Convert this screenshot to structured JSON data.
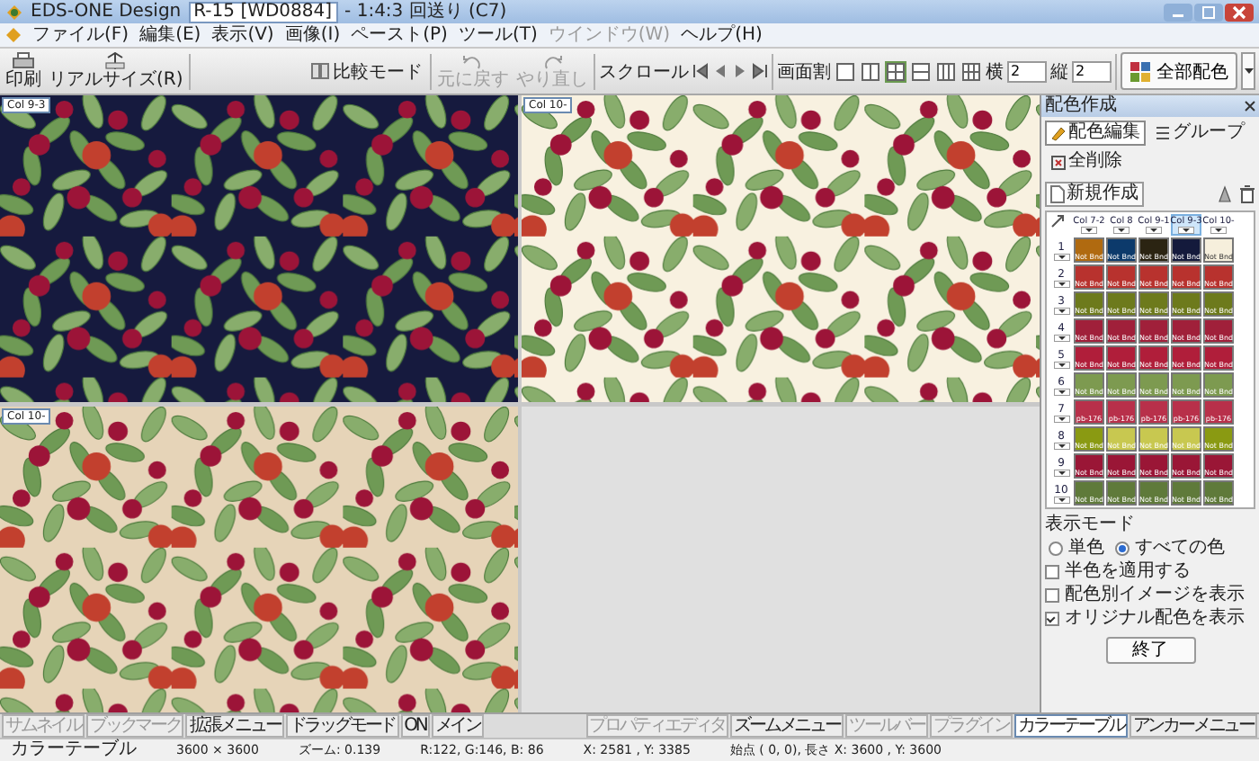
{
  "window": {
    "title": "EDS-ONE Design",
    "document": "R-15 [WD0884]",
    "subtitle": "- 1:4:3 回送り (C7)"
  },
  "menu": [
    {
      "label": "ファイル(F)",
      "disabled": false
    },
    {
      "label": "編集(E)",
      "disabled": false
    },
    {
      "label": "表示(V)",
      "disabled": false
    },
    {
      "label": "画像(I)",
      "disabled": false
    },
    {
      "label": "ペースト(P)",
      "disabled": false
    },
    {
      "label": "ツール(T)",
      "disabled": false
    },
    {
      "label": "ウインドウ(W)",
      "disabled": true
    },
    {
      "label": "ヘルプ(H)",
      "disabled": false
    }
  ],
  "toolbar": {
    "print": "印刷",
    "real_size": "リアルサイズ(R)",
    "compare": "比較モード",
    "undo": {
      "label": "元に戻す",
      "disabled": true
    },
    "redo": {
      "label": "やり直し",
      "disabled": true
    },
    "scroll": "スクロール",
    "split": {
      "label": "画面割",
      "layouts": [
        {
          "selected": false
        },
        {
          "selected": false
        },
        {
          "selected": true
        },
        {
          "selected": false
        },
        {
          "selected": false
        },
        {
          "selected": false
        }
      ]
    },
    "cols": {
      "label": "横",
      "value": "2"
    },
    "rows": {
      "label": "縦",
      "value": "2"
    },
    "apply": "全部配色"
  },
  "views": [
    {
      "label": "Col 9-3",
      "color": "#161a3e"
    },
    {
      "label": "Col 10-",
      "color": "#f8f1e0"
    },
    {
      "label": "Col 10-",
      "color": "#e6d4b8"
    }
  ],
  "panel": {
    "title": "配色作成",
    "buttons": [
      {
        "label": "配色編集",
        "selected": true
      },
      {
        "label": "グループ",
        "selected": false
      },
      {
        "label": "全削除",
        "selected": false
      }
    ],
    "new": "新規作成",
    "columns": [
      {
        "label": "Col 7-2",
        "selected": false
      },
      {
        "label": "Col 8",
        "selected": false
      },
      {
        "label": "Col 9-1",
        "selected": false
      },
      {
        "label": "Col 9-3",
        "selected": true
      },
      {
        "label": "Col 10-",
        "selected": false
      }
    ],
    "rows": [
      {
        "number": "1",
        "swatches": [
          {
            "color": "#b06a10",
            "code": "Not Bnd"
          },
          {
            "color": "#0c3a6b",
            "code": "Not Bnd"
          },
          {
            "color": "#2b2412",
            "code": "Not Bnd"
          },
          {
            "color": "#141a3c",
            "code": "Not Bnd"
          },
          {
            "color": "#f6efdc",
            "code": "Not Bnd"
          }
        ]
      },
      {
        "number": "2",
        "swatches": [
          {
            "color": "#b8322e",
            "code": "Not Bnd"
          },
          {
            "color": "#b8322e",
            "code": "Not Bnd"
          },
          {
            "color": "#b8322e",
            "code": "Not Bnd"
          },
          {
            "color": "#b8322e",
            "code": "Not Bnd"
          },
          {
            "color": "#b8322e",
            "code": "Not Bnd"
          }
        ]
      },
      {
        "number": "3",
        "swatches": [
          {
            "color": "#6d7a1c",
            "code": "Not Bnd"
          },
          {
            "color": "#6d7a1c",
            "code": "Not Bnd"
          },
          {
            "color": "#6d7a1c",
            "code": "Not Bnd"
          },
          {
            "color": "#6d7a1c",
            "code": "Not Bnd"
          },
          {
            "color": "#6d7a1c",
            "code": "Not Bnd"
          }
        ]
      },
      {
        "number": "4",
        "swatches": [
          {
            "color": "#a0203a",
            "code": "Not Bnd"
          },
          {
            "color": "#a0203a",
            "code": "Not Bnd"
          },
          {
            "color": "#a0203a",
            "code": "Not Bnd"
          },
          {
            "color": "#a0203a",
            "code": "Not Bnd"
          },
          {
            "color": "#a0203a",
            "code": "Not Bnd"
          }
        ]
      },
      {
        "number": "5",
        "swatches": [
          {
            "color": "#b01e3a",
            "code": "Not Bnd"
          },
          {
            "color": "#b01e3a",
            "code": "Not Bnd"
          },
          {
            "color": "#b01e3a",
            "code": "Not Bnd"
          },
          {
            "color": "#b01e3a",
            "code": "Not Bnd"
          },
          {
            "color": "#b01e3a",
            "code": "Not Bnd"
          }
        ]
      },
      {
        "number": "6",
        "swatches": [
          {
            "color": "#7d9a50",
            "code": "Not Bnd"
          },
          {
            "color": "#7d9a50",
            "code": "Not Bnd"
          },
          {
            "color": "#7d9a50",
            "code": "Not Bnd"
          },
          {
            "color": "#7d9a50",
            "code": "Not Bnd"
          },
          {
            "color": "#7d9a50",
            "code": "Not Bnd"
          }
        ]
      },
      {
        "number": "7",
        "swatches": [
          {
            "color": "#b8304a",
            "code": "pb-176"
          },
          {
            "color": "#b8304a",
            "code": "pb-176"
          },
          {
            "color": "#b8304a",
            "code": "pb-176"
          },
          {
            "color": "#b8304a",
            "code": "pb-176"
          },
          {
            "color": "#b8304a",
            "code": "pb-176"
          }
        ]
      },
      {
        "number": "8",
        "swatches": [
          {
            "color": "#8a9a12",
            "code": "Not Bnd"
          },
          {
            "color": "#c8c850",
            "code": "Not Bnd"
          },
          {
            "color": "#c8c850",
            "code": "Not Bnd"
          },
          {
            "color": "#c8c850",
            "code": "Not Bnd"
          },
          {
            "color": "#8a9a12",
            "code": "Not Bnd"
          }
        ]
      },
      {
        "number": "9",
        "swatches": [
          {
            "color": "#9a1636",
            "code": "Not Bnd"
          },
          {
            "color": "#9a1636",
            "code": "Not Bnd"
          },
          {
            "color": "#9a1636",
            "code": "Not Bnd"
          },
          {
            "color": "#9a1636",
            "code": "Not Bnd"
          },
          {
            "color": "#9a1636",
            "code": "Not Bnd"
          }
        ]
      },
      {
        "number": "10",
        "swatches": [
          {
            "color": "#5f7a3a",
            "code": "Not Bnd"
          },
          {
            "color": "#5f7a3a",
            "code": "Not Bnd"
          },
          {
            "color": "#5f7a3a",
            "code": "Not Bnd"
          },
          {
            "color": "#5f7a3a",
            "code": "Not Bnd"
          },
          {
            "color": "#5f7a3a",
            "code": "Not Bnd"
          }
        ]
      }
    ],
    "display_mode": {
      "label": "表示モード",
      "options": [
        {
          "label": "単色",
          "selected": false
        },
        {
          "label": "すべての色",
          "selected": true
        }
      ],
      "checks": [
        {
          "label": "半色を適用する",
          "checked": false
        },
        {
          "label": "配色別イメージを表示",
          "checked": false
        },
        {
          "label": "オリジナル配色を表示",
          "checked": true
        }
      ]
    },
    "close": "終了"
  },
  "bottom_tabs": [
    {
      "label": "サムネイル",
      "disabled": true,
      "selected": false
    },
    {
      "label": "ブックマーク",
      "disabled": true,
      "selected": false
    },
    {
      "label": "拡張メニュー",
      "disabled": false,
      "selected": false
    },
    {
      "label": "ドラッグモード",
      "disabled": false,
      "selected": false
    },
    {
      "label": "ON",
      "disabled": false,
      "selected": false
    },
    {
      "label": "メイン",
      "disabled": false,
      "selected": false
    },
    {
      "label": "プロパティエディタ",
      "disabled": true,
      "selected": false
    },
    {
      "label": "ズームメニュー",
      "disabled": false,
      "selected": false
    },
    {
      "label": "ツールバー",
      "disabled": true,
      "selected": false
    },
    {
      "label": "プラグイン",
      "disabled": true,
      "selected": false
    },
    {
      "label": "カラーテーブル",
      "disabled": false,
      "selected": true
    },
    {
      "label": "アンカーメニュー",
      "disabled": false,
      "selected": false
    }
  ],
  "status": [
    "カラーテーブル",
    "3600 × 3600",
    "ズーム: 0.139",
    "R:122, G:146, B: 86",
    "X: 2581 , Y: 3385",
    "始点 ( 0, 0), 長さ X: 3600 , Y: 3600"
  ]
}
